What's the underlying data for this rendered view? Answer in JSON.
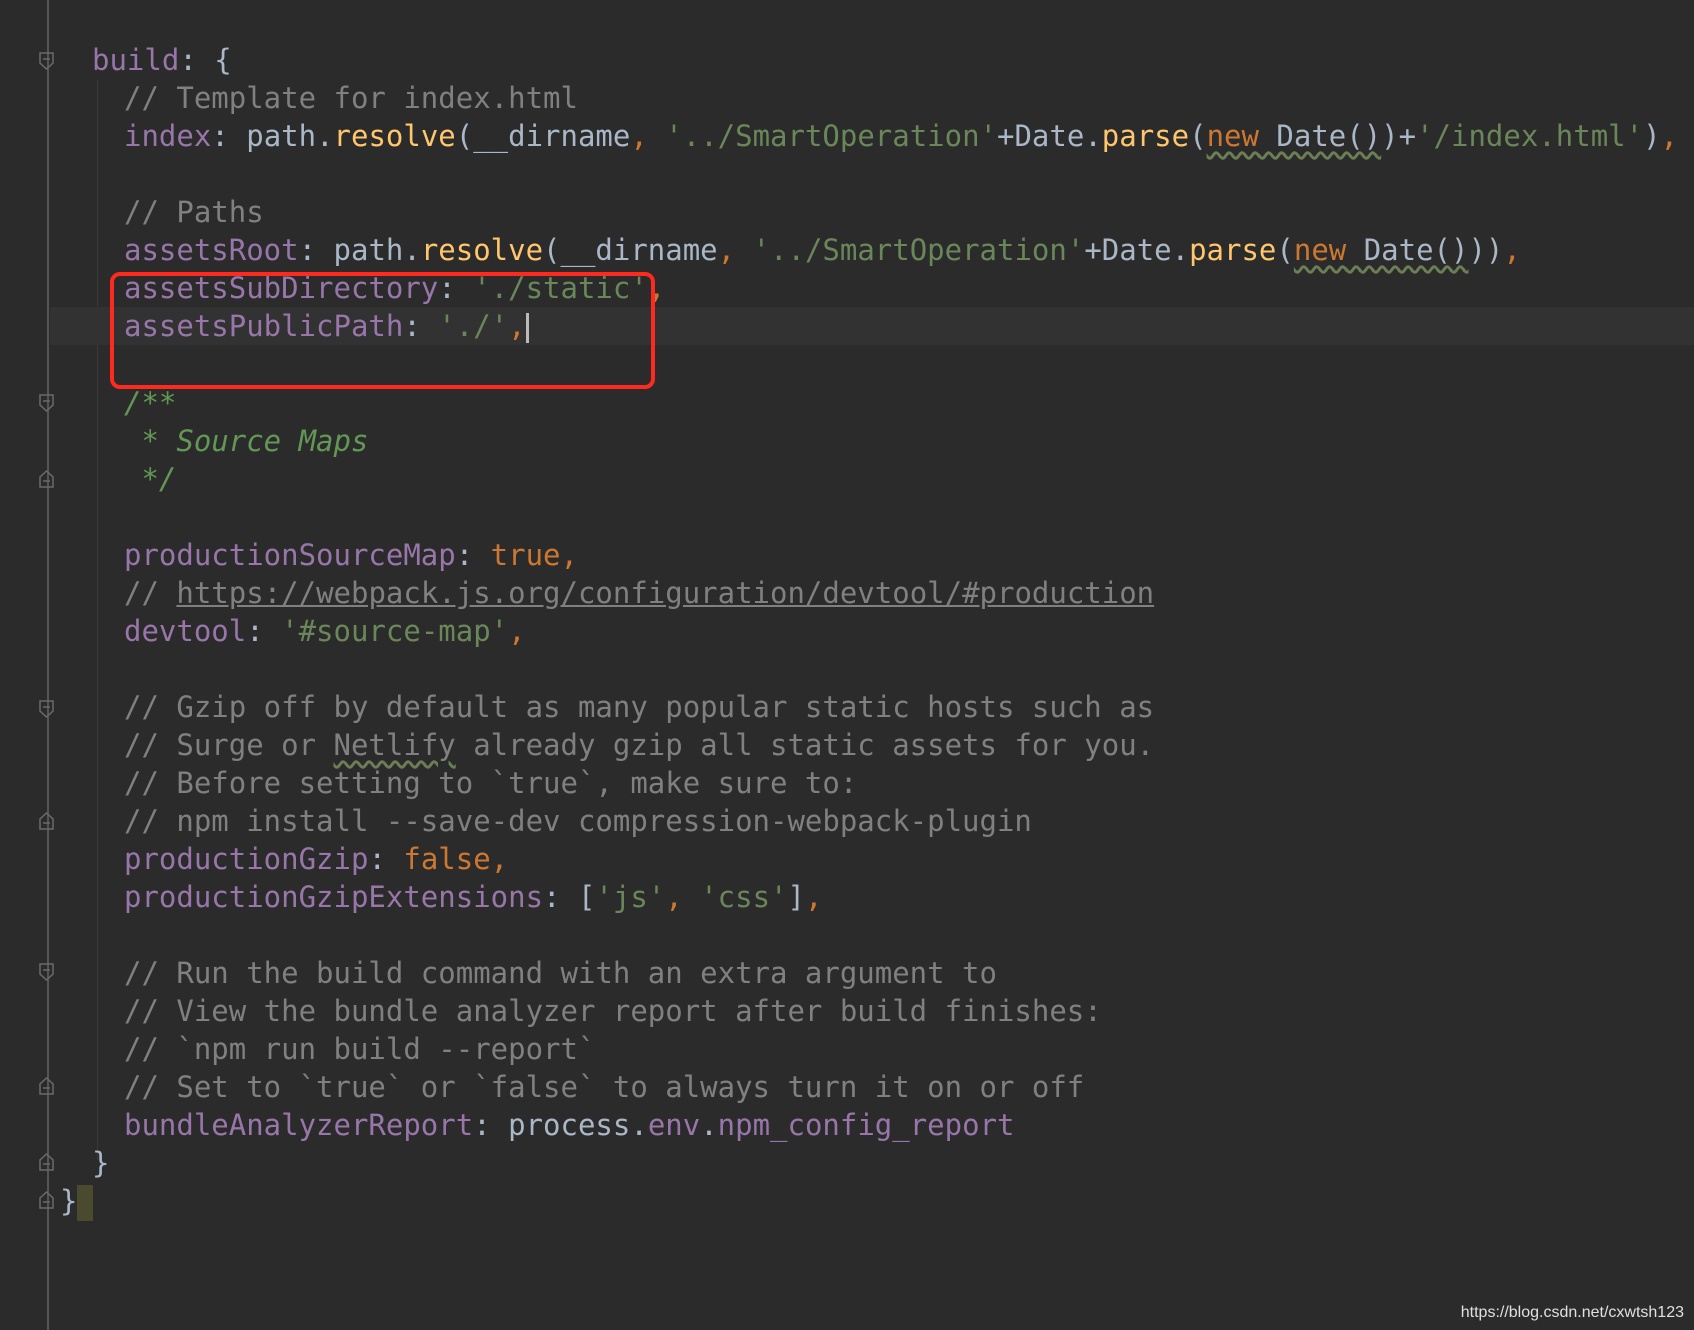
{
  "lines": [
    {
      "id": "build-open",
      "parts": [
        {
          "cls": "p",
          "text": "build"
        },
        {
          "cls": "t",
          "text": ": {"
        }
      ]
    },
    {
      "id": "comment-template",
      "parts": [
        {
          "cls": "c",
          "text": "// Template for index.html"
        }
      ]
    },
    {
      "id": "index",
      "parts": [
        {
          "cls": "p",
          "text": "index"
        },
        {
          "cls": "t",
          "text": ": path."
        },
        {
          "cls": "f",
          "text": "resolve"
        },
        {
          "cls": "t",
          "text": "(__dirname"
        },
        {
          "cls": "k",
          "text": ", "
        },
        {
          "cls": "s",
          "text": "'../SmartOperation'"
        },
        {
          "cls": "t",
          "text": "+Date."
        },
        {
          "cls": "f",
          "text": "parse"
        },
        {
          "cls": "t",
          "text": "("
        },
        {
          "cls": "k w",
          "text": "new"
        },
        {
          "cls": "t w",
          "text": " Date()"
        },
        {
          "cls": "t",
          "text": ")+"
        },
        {
          "cls": "s",
          "text": "'/index.html'"
        },
        {
          "cls": "t",
          "text": ")"
        },
        {
          "cls": "k",
          "text": ","
        }
      ]
    },
    {
      "id": "comment-paths",
      "parts": [
        {
          "cls": "c",
          "text": "// Paths"
        }
      ]
    },
    {
      "id": "assets-root",
      "parts": [
        {
          "cls": "p",
          "text": "assetsRoot"
        },
        {
          "cls": "t",
          "text": ": path."
        },
        {
          "cls": "f",
          "text": "resolve"
        },
        {
          "cls": "t",
          "text": "(__dirname"
        },
        {
          "cls": "k",
          "text": ", "
        },
        {
          "cls": "s",
          "text": "'../SmartOperation'"
        },
        {
          "cls": "t",
          "text": "+Date."
        },
        {
          "cls": "f",
          "text": "parse"
        },
        {
          "cls": "t",
          "text": "("
        },
        {
          "cls": "k w",
          "text": "new"
        },
        {
          "cls": "t w",
          "text": " Date()"
        },
        {
          "cls": "t",
          "text": "))"
        },
        {
          "cls": "k",
          "text": ","
        }
      ]
    },
    {
      "id": "assets-sub-directory",
      "parts": [
        {
          "cls": "p",
          "text": "assetsSubDirectory"
        },
        {
          "cls": "t",
          "text": ": "
        },
        {
          "cls": "s",
          "text": "'./static'"
        },
        {
          "cls": "k",
          "text": ","
        }
      ]
    },
    {
      "id": "assets-public-path",
      "parts": [
        {
          "cls": "p",
          "text": "assetsPublicPath"
        },
        {
          "cls": "t",
          "text": ": "
        },
        {
          "cls": "s",
          "text": "'./'"
        },
        {
          "cls": "k",
          "text": ","
        }
      ]
    },
    {
      "id": "doc-open",
      "parts": [
        {
          "cls": "d",
          "text": "/**"
        }
      ]
    },
    {
      "id": "doc-source-maps",
      "parts": [
        {
          "cls": "d",
          "text": " * Source Maps"
        }
      ]
    },
    {
      "id": "doc-close",
      "parts": [
        {
          "cls": "d",
          "text": " */"
        }
      ]
    },
    {
      "id": "production-source-map",
      "parts": [
        {
          "cls": "p",
          "text": "productionSourceMap"
        },
        {
          "cls": "t",
          "text": ": "
        },
        {
          "cls": "k",
          "text": "true,"
        }
      ]
    },
    {
      "id": "comment-url",
      "parts": [
        {
          "cls": "c",
          "text": "// "
        },
        {
          "cls": "u",
          "text": "https://webpack.js.org/configuration/devtool/#production"
        }
      ]
    },
    {
      "id": "devtool",
      "parts": [
        {
          "cls": "p",
          "text": "devtool"
        },
        {
          "cls": "t",
          "text": ": "
        },
        {
          "cls": "s",
          "text": "'#source-map'"
        },
        {
          "cls": "k",
          "text": ","
        }
      ]
    },
    {
      "id": "comment-gzip-1",
      "parts": [
        {
          "cls": "c",
          "text": "// Gzip off by default as many popular static hosts such as"
        }
      ]
    },
    {
      "id": "comment-gzip-2",
      "parts": [
        {
          "cls": "c",
          "text": "// Surge or "
        },
        {
          "cls": "c w",
          "text": "Netlify"
        },
        {
          "cls": "c",
          "text": " already gzip all static assets for you."
        }
      ]
    },
    {
      "id": "comment-gzip-3",
      "parts": [
        {
          "cls": "c",
          "text": "// Before setting to `true`, make sure to:"
        }
      ]
    },
    {
      "id": "comment-gzip-4",
      "parts": [
        {
          "cls": "c",
          "text": "// npm install --save-dev compression-webpack-plugin"
        }
      ]
    },
    {
      "id": "production-gzip",
      "parts": [
        {
          "cls": "p",
          "text": "productionGzip"
        },
        {
          "cls": "t",
          "text": ": "
        },
        {
          "cls": "k",
          "text": "false,"
        }
      ]
    },
    {
      "id": "production-gzip-extensions",
      "parts": [
        {
          "cls": "p",
          "text": "productionGzipExtensions"
        },
        {
          "cls": "t",
          "text": ": ["
        },
        {
          "cls": "s",
          "text": "'js'"
        },
        {
          "cls": "k",
          "text": ", "
        },
        {
          "cls": "s",
          "text": "'css'"
        },
        {
          "cls": "t",
          "text": "]"
        },
        {
          "cls": "k",
          "text": ","
        }
      ]
    },
    {
      "id": "comment-run-1",
      "parts": [
        {
          "cls": "c",
          "text": "// Run the build command with an extra argument to"
        }
      ]
    },
    {
      "id": "comment-run-2",
      "parts": [
        {
          "cls": "c",
          "text": "// View the bundle analyzer report after build finishes:"
        }
      ]
    },
    {
      "id": "comment-run-3",
      "parts": [
        {
          "cls": "c",
          "text": "// `npm run build --report`"
        }
      ]
    },
    {
      "id": "comment-run-4",
      "parts": [
        {
          "cls": "c",
          "text": "// Set to `true` or `false` to always turn it on or off"
        }
      ]
    },
    {
      "id": "bundle-analyzer-report",
      "parts": [
        {
          "cls": "p",
          "text": "bundleAnalyzerReport"
        },
        {
          "cls": "t",
          "text": ": process."
        },
        {
          "cls": "p",
          "text": "env"
        },
        {
          "cls": "t",
          "text": "."
        },
        {
          "cls": "p",
          "text": "npm_config_report"
        }
      ]
    },
    {
      "id": "build-close",
      "parts": [
        {
          "cls": "t",
          "text": "}"
        }
      ]
    },
    {
      "id": "root-close",
      "parts": [
        {
          "cls": "t",
          "text": "}"
        }
      ]
    }
  ],
  "watermark": "https://blog.csdn.net/cxwtsh123"
}
